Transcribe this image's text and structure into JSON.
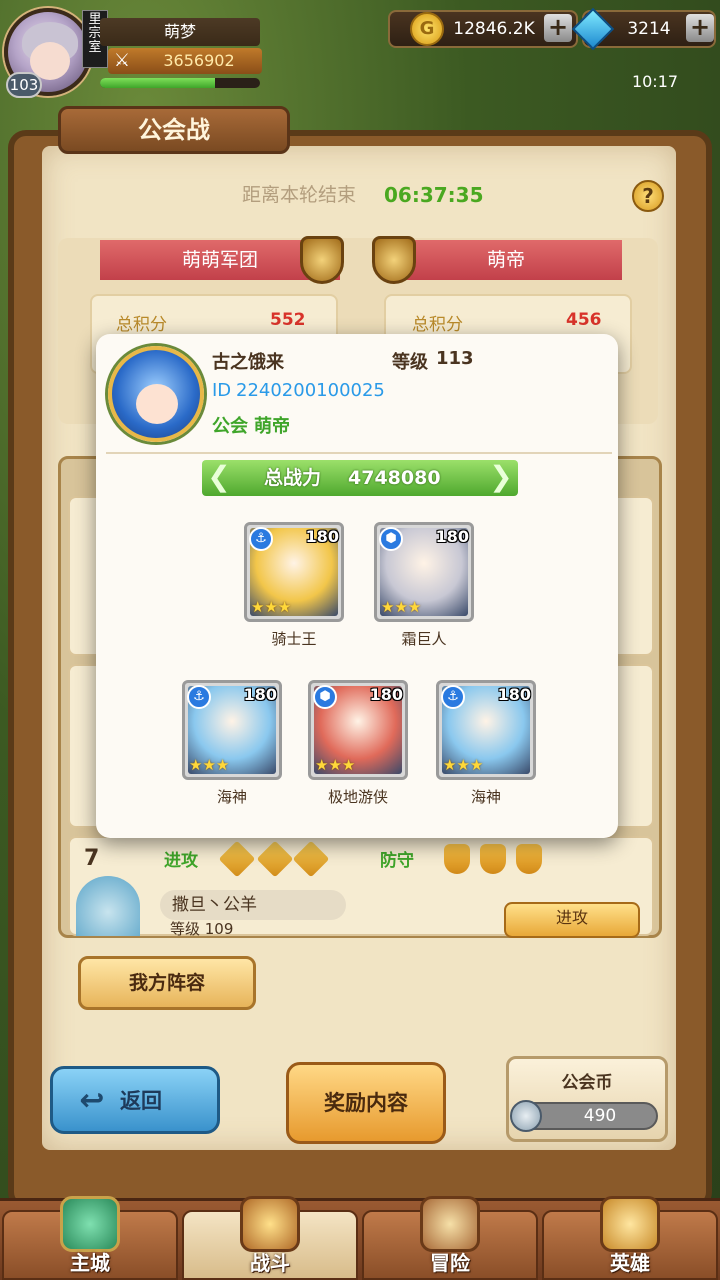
{
  "player": {
    "name": "萌梦",
    "power": "3656902",
    "level": "103",
    "vip_tag": "里宗室",
    "exp_progress": 0.72
  },
  "currency": {
    "gold": "12846.2K",
    "gems": "3214",
    "gold_icon_glyph": "G",
    "plus_glyph": "+"
  },
  "clock": "10:17",
  "screen": {
    "title": "公会战",
    "countdown_label": "距离本轮结束",
    "countdown_value": "06:37:35",
    "help_glyph": "?"
  },
  "versus": {
    "left_guild": "萌萌军团",
    "right_guild": "萌帝",
    "score_label": "总积分",
    "left_score": "552",
    "right_score": "456"
  },
  "list": {
    "row7": {
      "rank": "7",
      "attack_label": "进攻",
      "defense_label": "防守",
      "player_name": "撒旦丶公羊",
      "player_level": "等级 109",
      "attack_button": "进攻"
    }
  },
  "buttons": {
    "lineup": "我方阵容",
    "back": "返回",
    "back_arrow": "↩",
    "rewards": "奖励内容",
    "guild_coin_label": "公会币",
    "guild_coin_value": "490"
  },
  "nav": {
    "tabs": [
      {
        "label": "主城"
      },
      {
        "label": "战斗"
      },
      {
        "label": "冒险"
      },
      {
        "label": "英雄"
      }
    ],
    "active_index": 1
  },
  "popup": {
    "name": "古之饿来",
    "level_label": "等级",
    "level_value": "113",
    "id_label": "ID",
    "id_value": "2240200100025",
    "guild_label": "公会",
    "guild_value": "萌帝",
    "power_label": "总战力",
    "power_value": "4748080",
    "arrow_left": "❮",
    "arrow_right": "❯",
    "heroes": [
      {
        "name": "骑士王",
        "level": "180",
        "stars": "★★★",
        "type_icon": "anchor-icon",
        "type_glyph": "⚓",
        "art_color": "#f2c64a"
      },
      {
        "name": "霜巨人",
        "level": "180",
        "stars": "★★★",
        "type_icon": "hexagon-icon",
        "type_glyph": "⬢",
        "art_color": "#c8c8d4"
      },
      {
        "name": "海神",
        "level": "180",
        "stars": "★★★",
        "type_icon": "anchor-icon",
        "type_glyph": "⚓",
        "art_color": "#8ac8ee"
      },
      {
        "name": "极地游侠",
        "level": "180",
        "stars": "★★★",
        "type_icon": "hexagon-icon",
        "type_glyph": "⬢",
        "art_color": "#e06a5a"
      },
      {
        "name": "海神",
        "level": "180",
        "stars": "★★★",
        "type_icon": "anchor-icon",
        "type_glyph": "⚓",
        "art_color": "#8ac8ee"
      }
    ]
  }
}
